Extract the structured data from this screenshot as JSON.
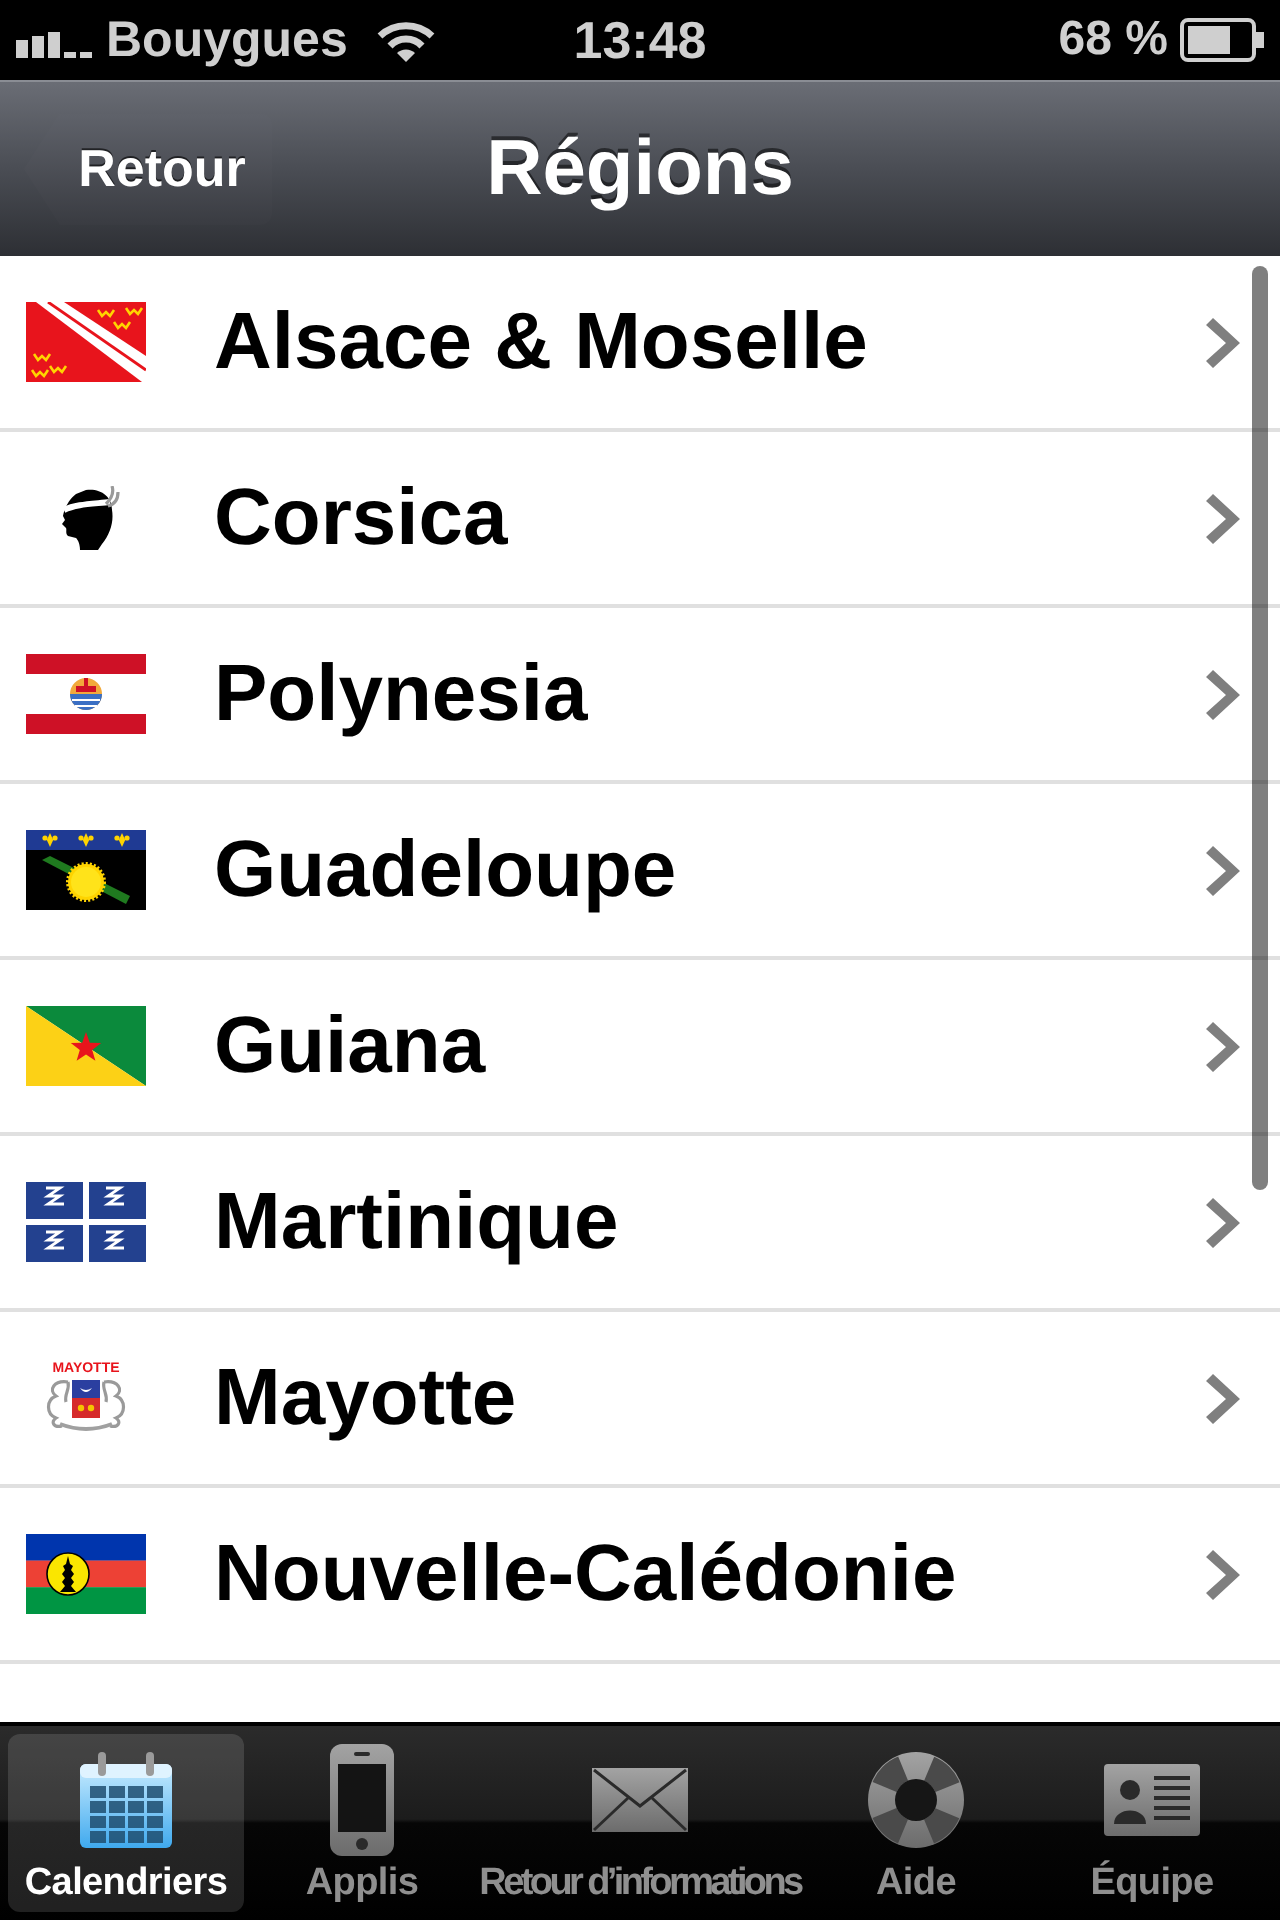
{
  "status_bar": {
    "carrier": "Bouygues",
    "time": "13:48",
    "battery": "68 %"
  },
  "nav_bar": {
    "back_button": "Retour",
    "title": "Régions"
  },
  "rows": [
    {
      "kind": "alsace",
      "label": "Alsace & Moselle"
    },
    {
      "kind": "corsica",
      "label": "Corsica"
    },
    {
      "kind": "polynesia",
      "label": "Polynesia"
    },
    {
      "kind": "guadeloupe",
      "label": "Guadeloupe"
    },
    {
      "kind": "guiana",
      "label": "Guiana"
    },
    {
      "kind": "martinique",
      "label": "Martinique"
    },
    {
      "kind": "mayotte",
      "label": "Mayotte",
      "emblem_text": "MAYOTTE"
    },
    {
      "kind": "caledonia",
      "label": "Nouvelle-Calédonie"
    }
  ],
  "tab_bar": [
    {
      "kind": "calendar",
      "label": "Calendriers",
      "selected": true
    },
    {
      "kind": "phone",
      "label": "Applis",
      "selected": false
    },
    {
      "kind": "envelope",
      "label": "Retour d’informations",
      "selected": false
    },
    {
      "kind": "lifebuoy",
      "label": "Aide",
      "selected": false
    },
    {
      "kind": "card",
      "label": "Équipe",
      "selected": false
    }
  ]
}
